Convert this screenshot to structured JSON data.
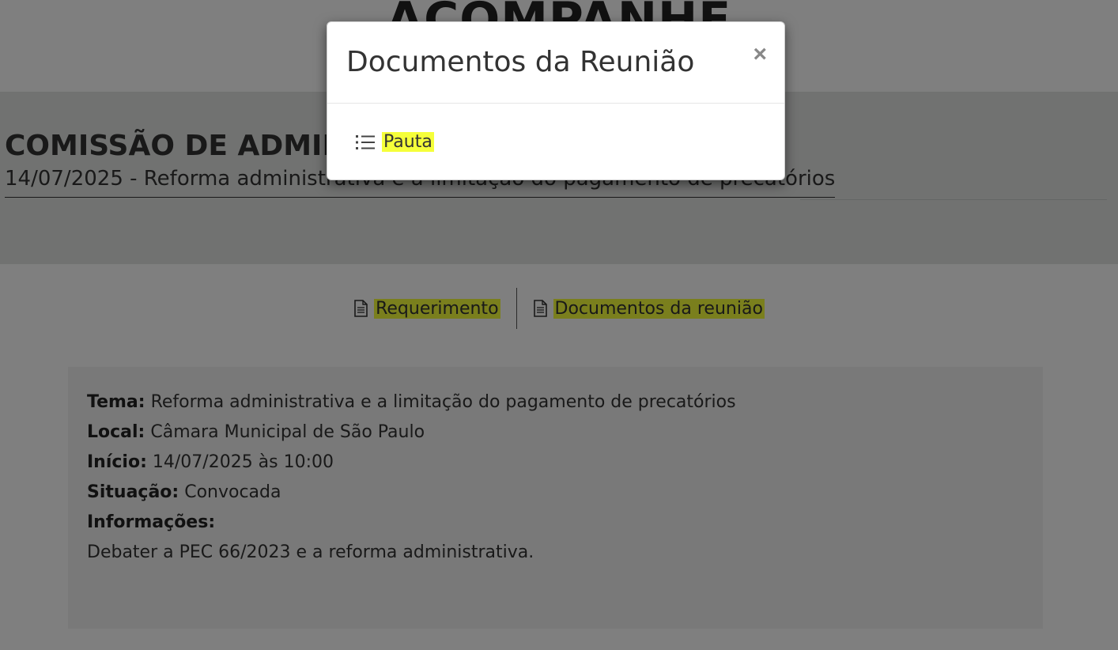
{
  "site": {
    "title": "ACOMPANHE"
  },
  "hero": {
    "committee_title": "COMISSÃO DE ADMINISTRAÇÃO PÚBLICA",
    "meeting_subtitle": "14/07/2025 - Reforma administrativa e a limitação do pagamento de precatórios"
  },
  "doc_links": {
    "requerimento": "Requerimento",
    "documentos": "Documentos da reunião",
    "icon": "document-icon",
    "highlight_color": "#f5ff3a"
  },
  "info": {
    "tema_label": "Tema:",
    "tema_value": "Reforma administrativa e a limitação do pagamento de precatórios",
    "local_label": "Local:",
    "local_value": "Câmara Municipal de São Paulo",
    "inicio_label": "Início:",
    "inicio_value": "14/07/2025 às 10:00",
    "situacao_label": "Situação:",
    "situacao_value": "Convocada",
    "informacoes_label": "Informações:",
    "description": "Debater a PEC 66/2023 e a reforma administrativa."
  },
  "modal": {
    "title": "Documentos da Reunião",
    "close_label": "×",
    "items": [
      {
        "label": "Pauta",
        "icon": "list-icon"
      }
    ]
  }
}
